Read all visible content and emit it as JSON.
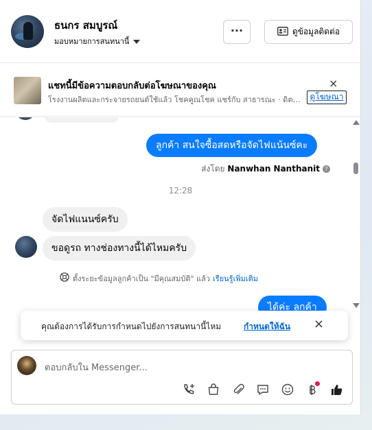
{
  "header": {
    "name": "ธนกร สมบูรณ์",
    "assign_label": "มอบหมายการสนทนานี้",
    "more_label": "···",
    "contact_label": "ดูข้อมูลติดต่อ"
  },
  "ad": {
    "title": "แชทนี้มีข้อความตอบกลับต่อโฆษณาของคุณ",
    "subtitle": "โรงงานผลิตและกระจายรถยนต์ใช้แล้ว โชคคูณโชค แชร์กับ สาธารณะ · ดิตต...",
    "link_label": "ดูโฆษณา",
    "close_icon": "×"
  },
  "chat": {
    "outgoing_1": "ลูกค้า  สนใจซื้อสดหรือจัดไฟแน้นซ์คะ",
    "sent_by_prefix": "ส่งโดย",
    "sent_by_name": "Nanwhan Nanthanit",
    "help_glyph": "?",
    "timestamp": "12:28",
    "incoming_1": "จัดไฟแนนซ์ครับ",
    "incoming_2": "ขอดูรถ ทางช่องทางนี้ได้ไหมครับ",
    "notice_text": "ตั้งระยะข้อมูลลูกค้าเป็น \"มีคุณสมบัติ\" แล้ว",
    "notice_link": "เรียนรู้เพิ่มเติม",
    "outgoing_partial": "ได้ค่ะ  ลูกค้า"
  },
  "toast": {
    "text": "คุณต้องการได้รับการกำหนดไปยังการสนทนานี้ไหม",
    "link": "กำหนดให้ฉัน",
    "close_icon": "×"
  },
  "composer": {
    "placeholder": "ตอบกลับใน Messenger..."
  },
  "colors": {
    "accent": "#0a7cff",
    "link": "#0064d1",
    "badge": "#e41e3f"
  }
}
